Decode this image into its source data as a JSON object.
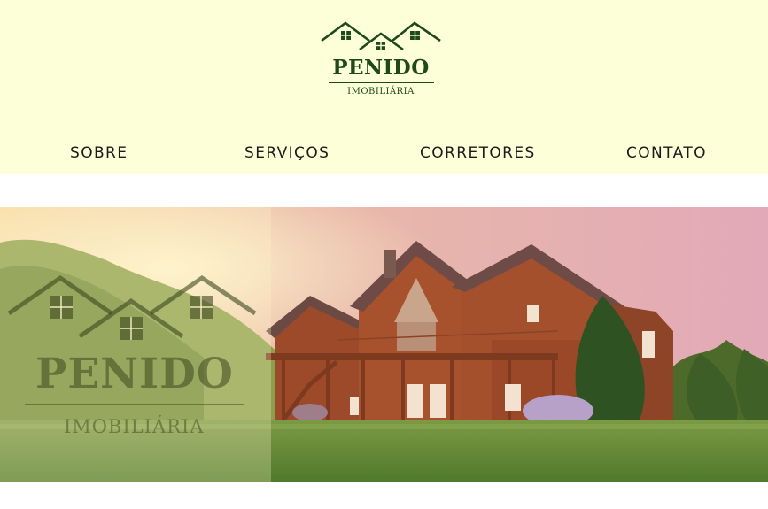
{
  "brand": {
    "name": "PENIDO",
    "subtitle": "IMOBILIÁRIA",
    "color": "#1f4a17"
  },
  "nav": {
    "items": [
      {
        "label": "SOBRE"
      },
      {
        "label": "SERVIÇOS"
      },
      {
        "label": "CORRETORES"
      },
      {
        "label": "CONTATO"
      }
    ]
  },
  "hero": {
    "image": "log-house-at-sunset",
    "overlay_logo": {
      "name": "PENIDO",
      "subtitle": "IMOBILIÁRIA"
    }
  },
  "colors": {
    "header_bg": "#fdffd8",
    "nav_text": "#1a1a1a"
  }
}
